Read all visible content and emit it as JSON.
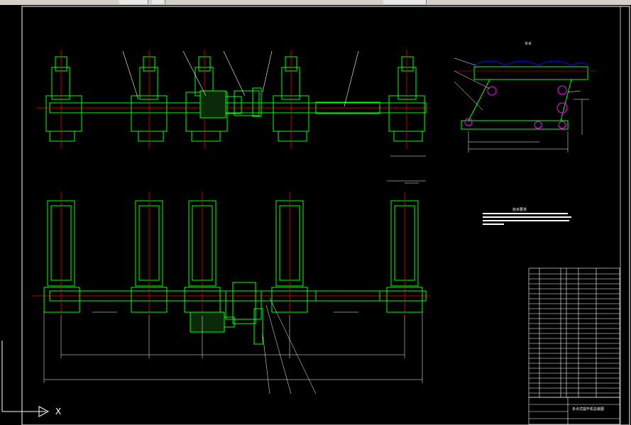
{
  "app": {
    "type": "cad-viewer",
    "background": "#000000",
    "colors": {
      "frame": "#ffffff",
      "geometry": "#00ff00",
      "centerline": "#ff0000",
      "annotation": "#ffffff",
      "highlight": "#ff00ff",
      "accent": "#0000ff"
    }
  },
  "toolbar": {
    "strip_visible": true
  },
  "drawing": {
    "section_label": "B-B",
    "notes_title": "技术要求",
    "title_block_text": "多点式提升机总装图",
    "ucs_axis_label": "X"
  }
}
